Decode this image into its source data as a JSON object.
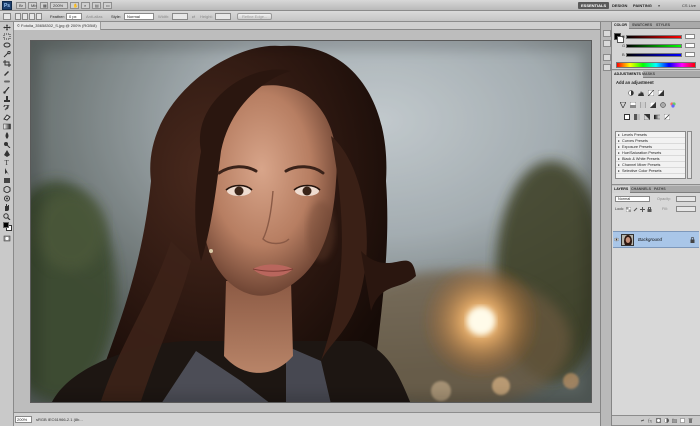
{
  "app": {
    "logo_text": "Ps",
    "zoom_menu": "200%",
    "workspaces": [
      "ESSENTIALS",
      "DESIGN",
      "PAINTING"
    ],
    "workspace_more": "»",
    "cs_live": "CS Live"
  },
  "options_bar": {
    "feather_label": "Feather:",
    "feather_value": "0 px",
    "antialias_label": "Anti-alias",
    "style_label": "Style:",
    "style_value": "Normal",
    "width_label": "Width:",
    "height_label": "Height:",
    "refine_edge": "Refine Edge..."
  },
  "document": {
    "tab_title": "© Fotolia_35658302_S.jpg @ 200% (RGB/8)",
    "zoom": "200%",
    "profile": "sRGB IEC61966-2.1 (8b..."
  },
  "panels": {
    "color_tabs": [
      "COLOR",
      "SWATCHES",
      "STYLES"
    ],
    "slider_labels": [
      "R",
      "G",
      "B"
    ],
    "adjustments_tabs": [
      "ADJUSTMENTS",
      "MASKS"
    ],
    "adjustments_title": "Add an adjustment",
    "presets": [
      "Levels Presets",
      "Curves Presets",
      "Exposure Presets",
      "Hue/Saturation Presets",
      "Black & White Presets",
      "Channel Mixer Presets",
      "Selective Color Presets"
    ],
    "layers_tabs": [
      "LAYERS",
      "CHANNELS",
      "PATHS"
    ],
    "blend_mode": "Normal",
    "opacity_label": "Opacity:",
    "lock_label": "Lock:",
    "fill_label": "Fill:",
    "layer_name": "Background"
  },
  "colors": {
    "accent_selected_layer": "#a9c6e8",
    "ui_gray": "#c9c9c9",
    "workspace_active": "#5a5a5a"
  }
}
